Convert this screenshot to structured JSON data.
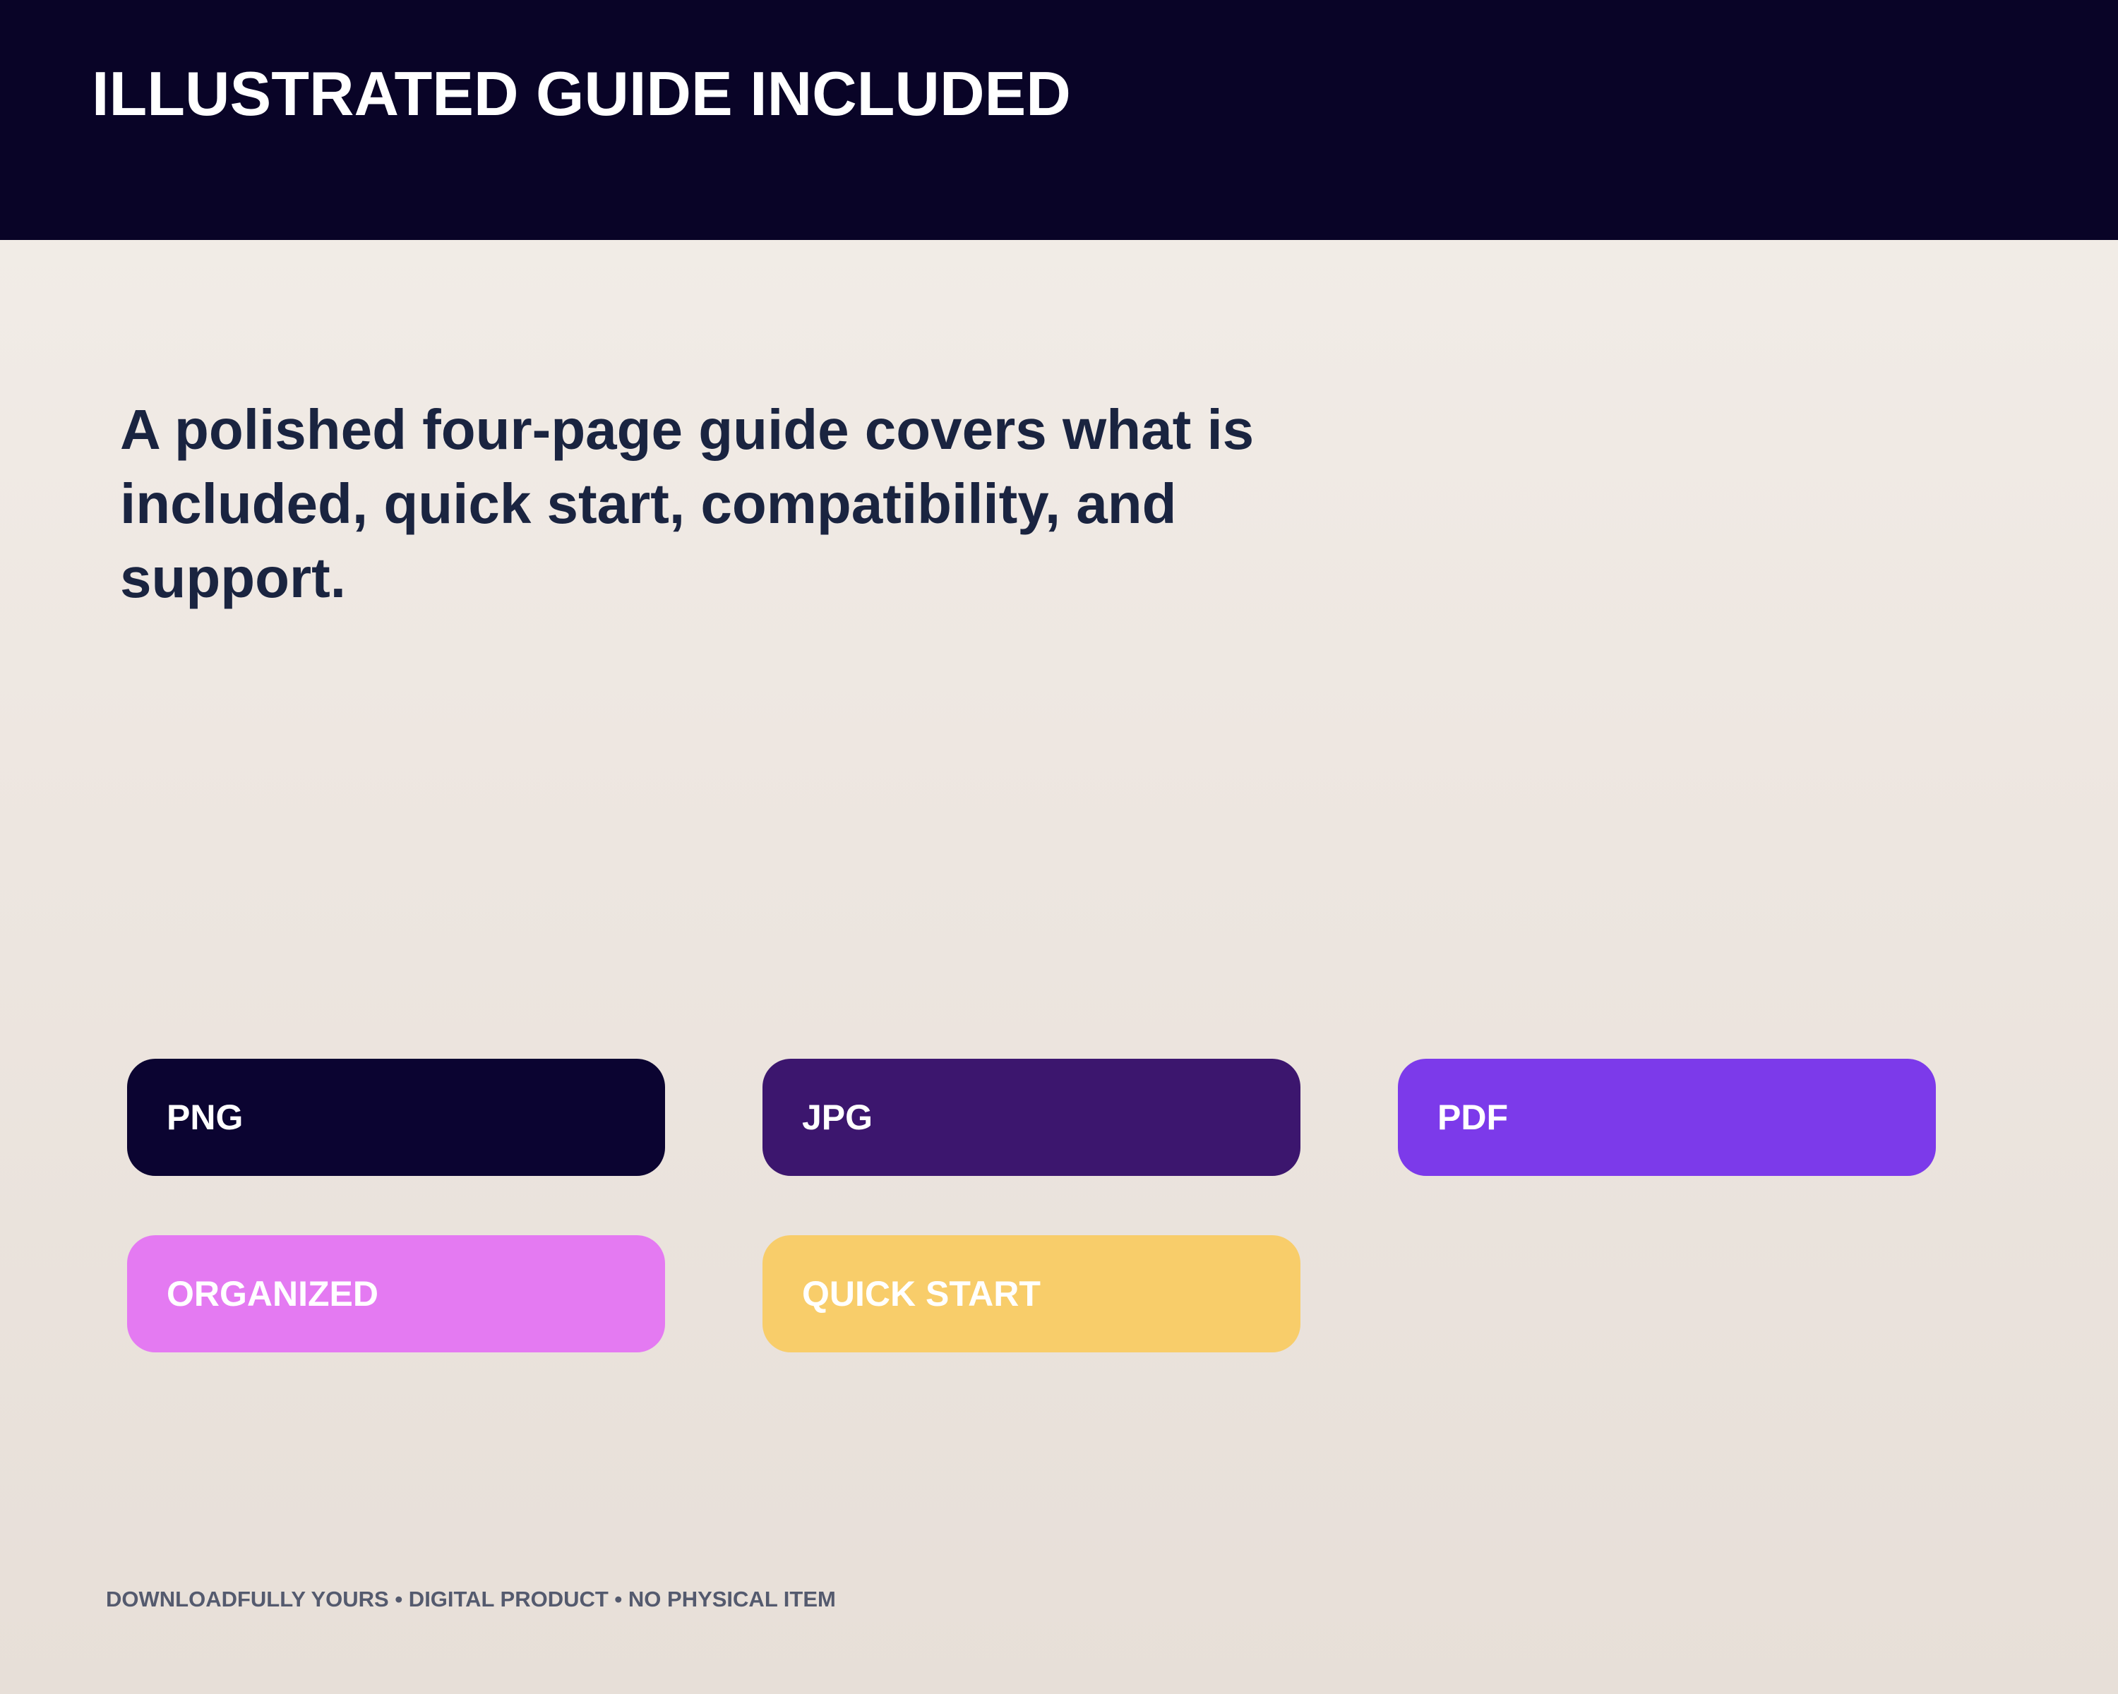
{
  "header": {
    "title": "ILLUSTRATED GUIDE INCLUDED",
    "background_color": "#090427"
  },
  "main": {
    "description": "A polished four-page guide covers what is included, quick start, compatibility, and support."
  },
  "tags": [
    {
      "label": "PNG",
      "color": "#0b0431"
    },
    {
      "label": "JPG",
      "color": "#3c166e"
    },
    {
      "label": "PDF",
      "color": "#7c3aea"
    },
    {
      "label": "ORGANIZED",
      "color": "#e47af2"
    },
    {
      "label": "QUICK START",
      "color": "#f8cd6a"
    }
  ],
  "footer": {
    "text": "DOWNLOADFULLY YOURS • DIGITAL PRODUCT • NO PHYSICAL ITEM"
  }
}
